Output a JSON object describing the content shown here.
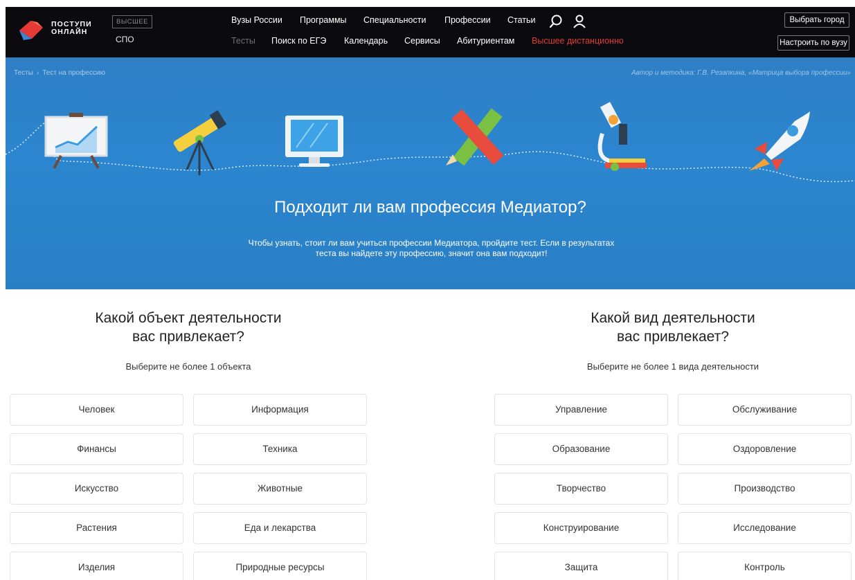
{
  "header": {
    "logo_line1": "ПОСТУПИ",
    "logo_line2": "ОНЛАЙН",
    "level_high": "ВЫСШЕЕ",
    "level_spo": "СПО",
    "nav_primary": [
      "Вузы России",
      "Программы",
      "Специальности",
      "Профессии",
      "Статьи"
    ],
    "nav_secondary": [
      "Тесты",
      "Поиск по ЕГЭ",
      "Календарь",
      "Сервисы",
      "Абитуриентам",
      "Высшее дистанционно"
    ],
    "select_city_button": "Выбрать город",
    "setup_vuz_button": "Настроить по вузу",
    "icons": [
      "search-icon",
      "user-icon"
    ]
  },
  "breadcrumb": {
    "items": [
      "Тесты",
      "Тест на профессию"
    ],
    "separator": "›"
  },
  "hero": {
    "author": "Автор и методика: Г.В. Резапкина, «Матрица выбора профессии»",
    "title": "Подходит ли вам профессия Медиатор?",
    "subtitle_line1": "Чтобы узнать, стоит ли вам учиться профессии Медиатора, пройдите тест. Если в результатах",
    "subtitle_line2": "теста вы найдете эту профессию, значит она вам подходит!",
    "illustrations": [
      "presentation-board-icon",
      "telescope-icon",
      "monitor-icon",
      "ruler-pencil-icon",
      "microscope-icon",
      "rocket-icon"
    ]
  },
  "objects": {
    "title_line1": "Какой объект деятельности",
    "title_line2": "вас привлекает?",
    "hint": "Выберите не более 1 объекта",
    "options": [
      "Человек",
      "Информация",
      "Финансы",
      "Техника",
      "Искусство",
      "Животные",
      "Растения",
      "Еда и лекарства",
      "Изделия",
      "Природные ресурсы"
    ]
  },
  "activities": {
    "title_line1": "Какой вид деятельности",
    "title_line2": "вас привлекает?",
    "hint": "Выберите не более 1 вида деятельности",
    "options": [
      "Управление",
      "Обслуживание",
      "Образование",
      "Оздоровление",
      "Творчество",
      "Производство",
      "Конструирование",
      "Исследование",
      "Защита",
      "Контроль"
    ]
  },
  "colors": {
    "header_bg": "#0b0b0f",
    "hero_blue": "#2b86cf",
    "accent_red": "#e53935"
  }
}
